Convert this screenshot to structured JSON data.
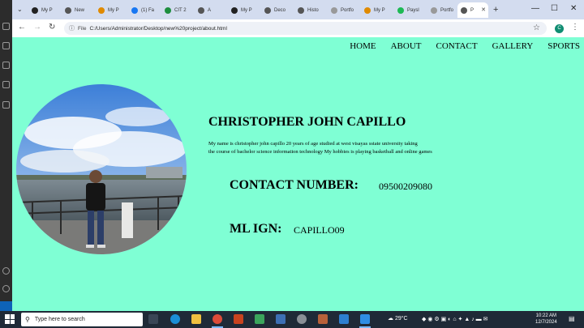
{
  "browser": {
    "tabs": [
      {
        "label": "My P",
        "color": "#222222"
      },
      {
        "label": "New",
        "color": "#555555"
      },
      {
        "label": "My P",
        "color": "#e08a00"
      },
      {
        "label": "(1) Fa",
        "color": "#1877f2"
      },
      {
        "label": "CIT 2",
        "color": "#1e8e3e"
      },
      {
        "label": "A",
        "color": "#555555"
      },
      {
        "label": "My P",
        "color": "#222222"
      },
      {
        "label": "Deco",
        "color": "#555555"
      },
      {
        "label": "Histo",
        "color": "#555555"
      },
      {
        "label": "Portfo",
        "color": "#999999"
      },
      {
        "label": "My P",
        "color": "#e08a00"
      },
      {
        "label": "Paysl",
        "color": "#1db954"
      },
      {
        "label": "Portfo",
        "color": "#999999"
      }
    ],
    "active_tab": {
      "label": "P",
      "close": "✕"
    },
    "new_tab": "+",
    "window_controls": {
      "minimize": "—",
      "maximize": "☐",
      "close": "✕"
    },
    "address": {
      "scheme": "File",
      "url": "C:/Users/Administrator/Desktop/new%20project/about.html"
    },
    "profile_initial": "C"
  },
  "page": {
    "nav": [
      "HOME",
      "ABOUT",
      "CONTACT",
      "GALLERY",
      "SPORTS"
    ],
    "name": "CHRISTOPHER JOHN CAPILLO",
    "bio_line1": "My name is christopher john capillo 20 years of age studied at west visayas sstate university taking",
    "bio_line2": "the course of bachelor science information technology My hobbies is playing basketball and online games",
    "contact_label": "CONTACT NUMBER:",
    "contact_value": "09500209080",
    "ign_label": "ML IGN:",
    "ign_value": "CAPILLO09"
  },
  "taskbar": {
    "search_placeholder": "Type here to search",
    "weather": "29°C",
    "time": "10:22 AM",
    "date": "12/7/2024"
  }
}
